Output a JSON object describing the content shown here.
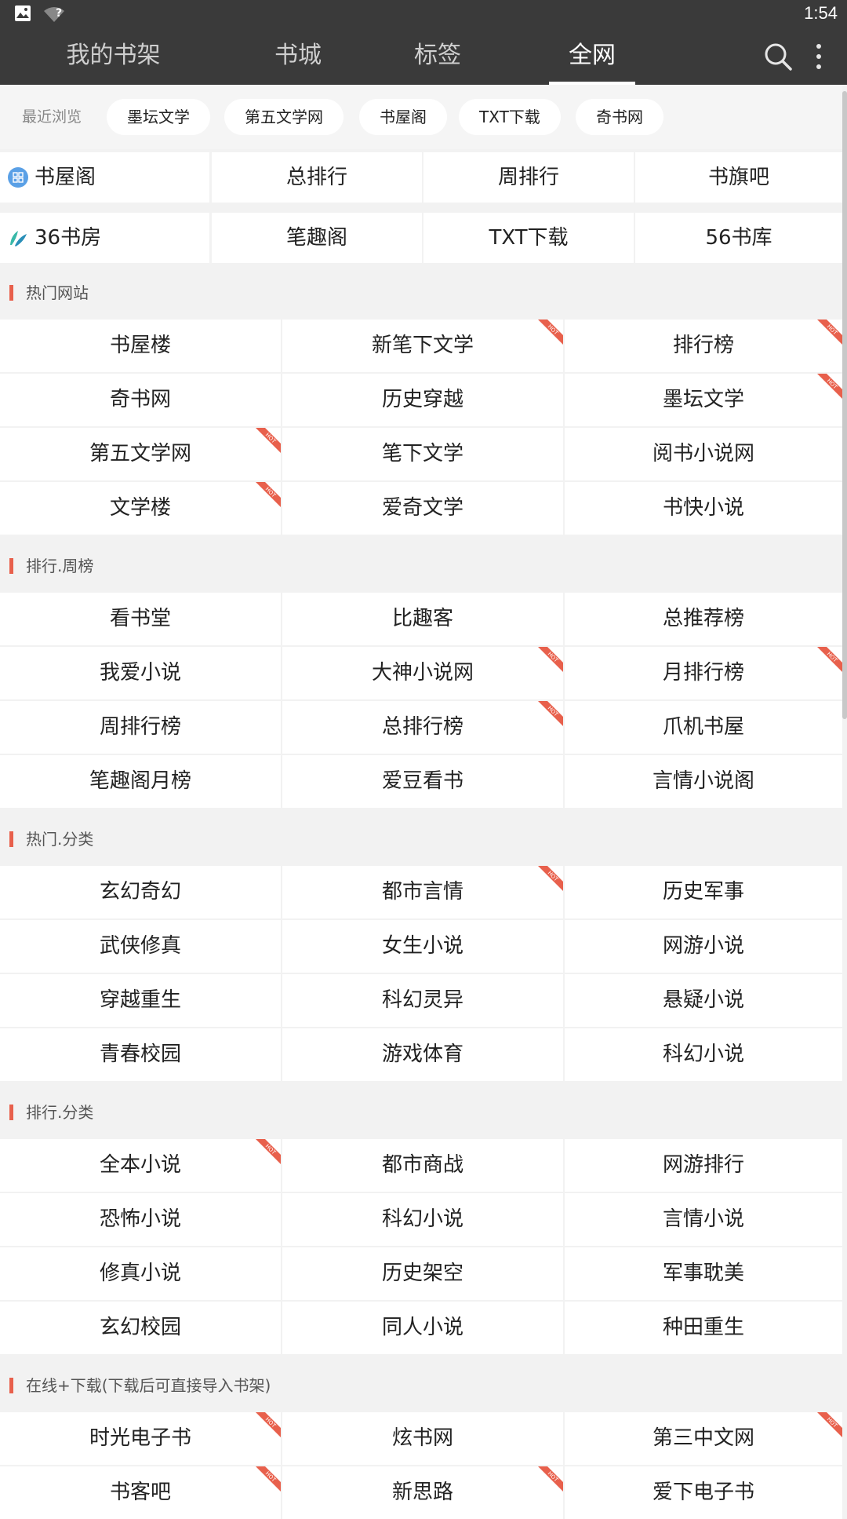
{
  "status_bar": {
    "time": "1:54",
    "wifi_mark": "?"
  },
  "app_bar": {
    "tabs": [
      {
        "label": "我的书架",
        "active": false
      },
      {
        "label": "书城",
        "active": false
      },
      {
        "label": "标签",
        "active": false
      },
      {
        "label": "全网",
        "active": true
      }
    ],
    "actions": [
      "search-icon",
      "more-vert-icon"
    ]
  },
  "recent": {
    "label": "最近浏览",
    "chips": [
      "墨坛文学",
      "第五文学网",
      "书屋阁",
      "TXT下载",
      "奇书网"
    ]
  },
  "top_sites": [
    {
      "site": "书屋阁",
      "logo": "grid-badge-icon",
      "links": [
        "总排行",
        "周排行",
        "书旗吧"
      ]
    },
    {
      "site": "36书房",
      "logo": "leaf-logo-icon",
      "links": [
        "笔趣阁",
        "TXT下载",
        "56书库"
      ]
    }
  ],
  "sections": [
    {
      "title": "热门网站",
      "items": [
        {
          "label": "书屋楼",
          "hot": false
        },
        {
          "label": "新笔下文学",
          "hot": true
        },
        {
          "label": "排行榜",
          "hot": true
        },
        {
          "label": "奇书网",
          "hot": false
        },
        {
          "label": "历史穿越",
          "hot": false
        },
        {
          "label": "墨坛文学",
          "hot": true
        },
        {
          "label": "第五文学网",
          "hot": true
        },
        {
          "label": "笔下文学",
          "hot": false
        },
        {
          "label": "阅书小说网",
          "hot": false
        },
        {
          "label": "文学楼",
          "hot": true
        },
        {
          "label": "爱奇文学",
          "hot": false
        },
        {
          "label": "书快小说",
          "hot": false
        }
      ]
    },
    {
      "title": "排行.周榜",
      "items": [
        {
          "label": "看书堂",
          "hot": false
        },
        {
          "label": "比趣客",
          "hot": false
        },
        {
          "label": "总推荐榜",
          "hot": false
        },
        {
          "label": "我爱小说",
          "hot": false
        },
        {
          "label": "大神小说网",
          "hot": true
        },
        {
          "label": "月排行榜",
          "hot": true
        },
        {
          "label": "周排行榜",
          "hot": false
        },
        {
          "label": "总排行榜",
          "hot": true
        },
        {
          "label": "爪机书屋",
          "hot": false
        },
        {
          "label": "笔趣阁月榜",
          "hot": false
        },
        {
          "label": "爱豆看书",
          "hot": false
        },
        {
          "label": "言情小说阁",
          "hot": false
        }
      ]
    },
    {
      "title": "热门.分类",
      "items": [
        {
          "label": "玄幻奇幻",
          "hot": false
        },
        {
          "label": "都市言情",
          "hot": true
        },
        {
          "label": "历史军事",
          "hot": false
        },
        {
          "label": "武侠修真",
          "hot": false
        },
        {
          "label": "女生小说",
          "hot": false
        },
        {
          "label": "网游小说",
          "hot": false
        },
        {
          "label": "穿越重生",
          "hot": false
        },
        {
          "label": "科幻灵异",
          "hot": false
        },
        {
          "label": "悬疑小说",
          "hot": false
        },
        {
          "label": "青春校园",
          "hot": false
        },
        {
          "label": "游戏体育",
          "hot": false
        },
        {
          "label": "科幻小说",
          "hot": false
        }
      ]
    },
    {
      "title": "排行.分类",
      "items": [
        {
          "label": "全本小说",
          "hot": true
        },
        {
          "label": "都市商战",
          "hot": false
        },
        {
          "label": "网游排行",
          "hot": false
        },
        {
          "label": "恐怖小说",
          "hot": false
        },
        {
          "label": "科幻小说",
          "hot": false
        },
        {
          "label": "言情小说",
          "hot": false
        },
        {
          "label": "修真小说",
          "hot": false
        },
        {
          "label": "历史架空",
          "hot": false
        },
        {
          "label": "军事耽美",
          "hot": false
        },
        {
          "label": "玄幻校园",
          "hot": false
        },
        {
          "label": "同人小说",
          "hot": false
        },
        {
          "label": "种田重生",
          "hot": false
        }
      ]
    },
    {
      "title": "在线+下载(下载后可直接导入书架)",
      "items": [
        {
          "label": "时光电子书",
          "hot": true
        },
        {
          "label": "炫书网",
          "hot": false
        },
        {
          "label": "第三中文网",
          "hot": true
        },
        {
          "label": "书客吧",
          "hot": true
        },
        {
          "label": "新思路",
          "hot": true
        },
        {
          "label": "爱下电子书",
          "hot": false
        }
      ]
    }
  ],
  "hot_badge_text": "HOT",
  "colors": {
    "appbar": "#3a3a3a",
    "accent": "#e8604c",
    "background": "#f2f2f2"
  }
}
